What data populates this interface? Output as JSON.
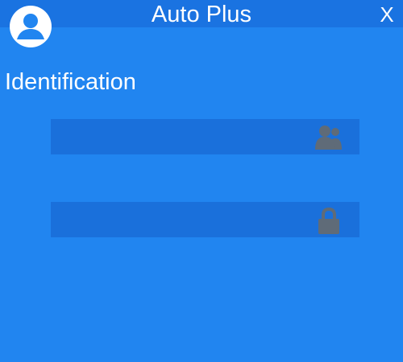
{
  "window": {
    "title": "Auto Plus",
    "close_label": "X"
  },
  "login": {
    "heading": "Identification",
    "username": {
      "value": "",
      "placeholder": "",
      "icon": "users-icon"
    },
    "password": {
      "value": "",
      "placeholder": "",
      "icon": "lock-icon"
    }
  },
  "colors": {
    "background": "#2185f0",
    "titlebar": "#1a73e1",
    "field": "#1a70db",
    "icon": "#5f6b78",
    "text": "#ffffff"
  }
}
